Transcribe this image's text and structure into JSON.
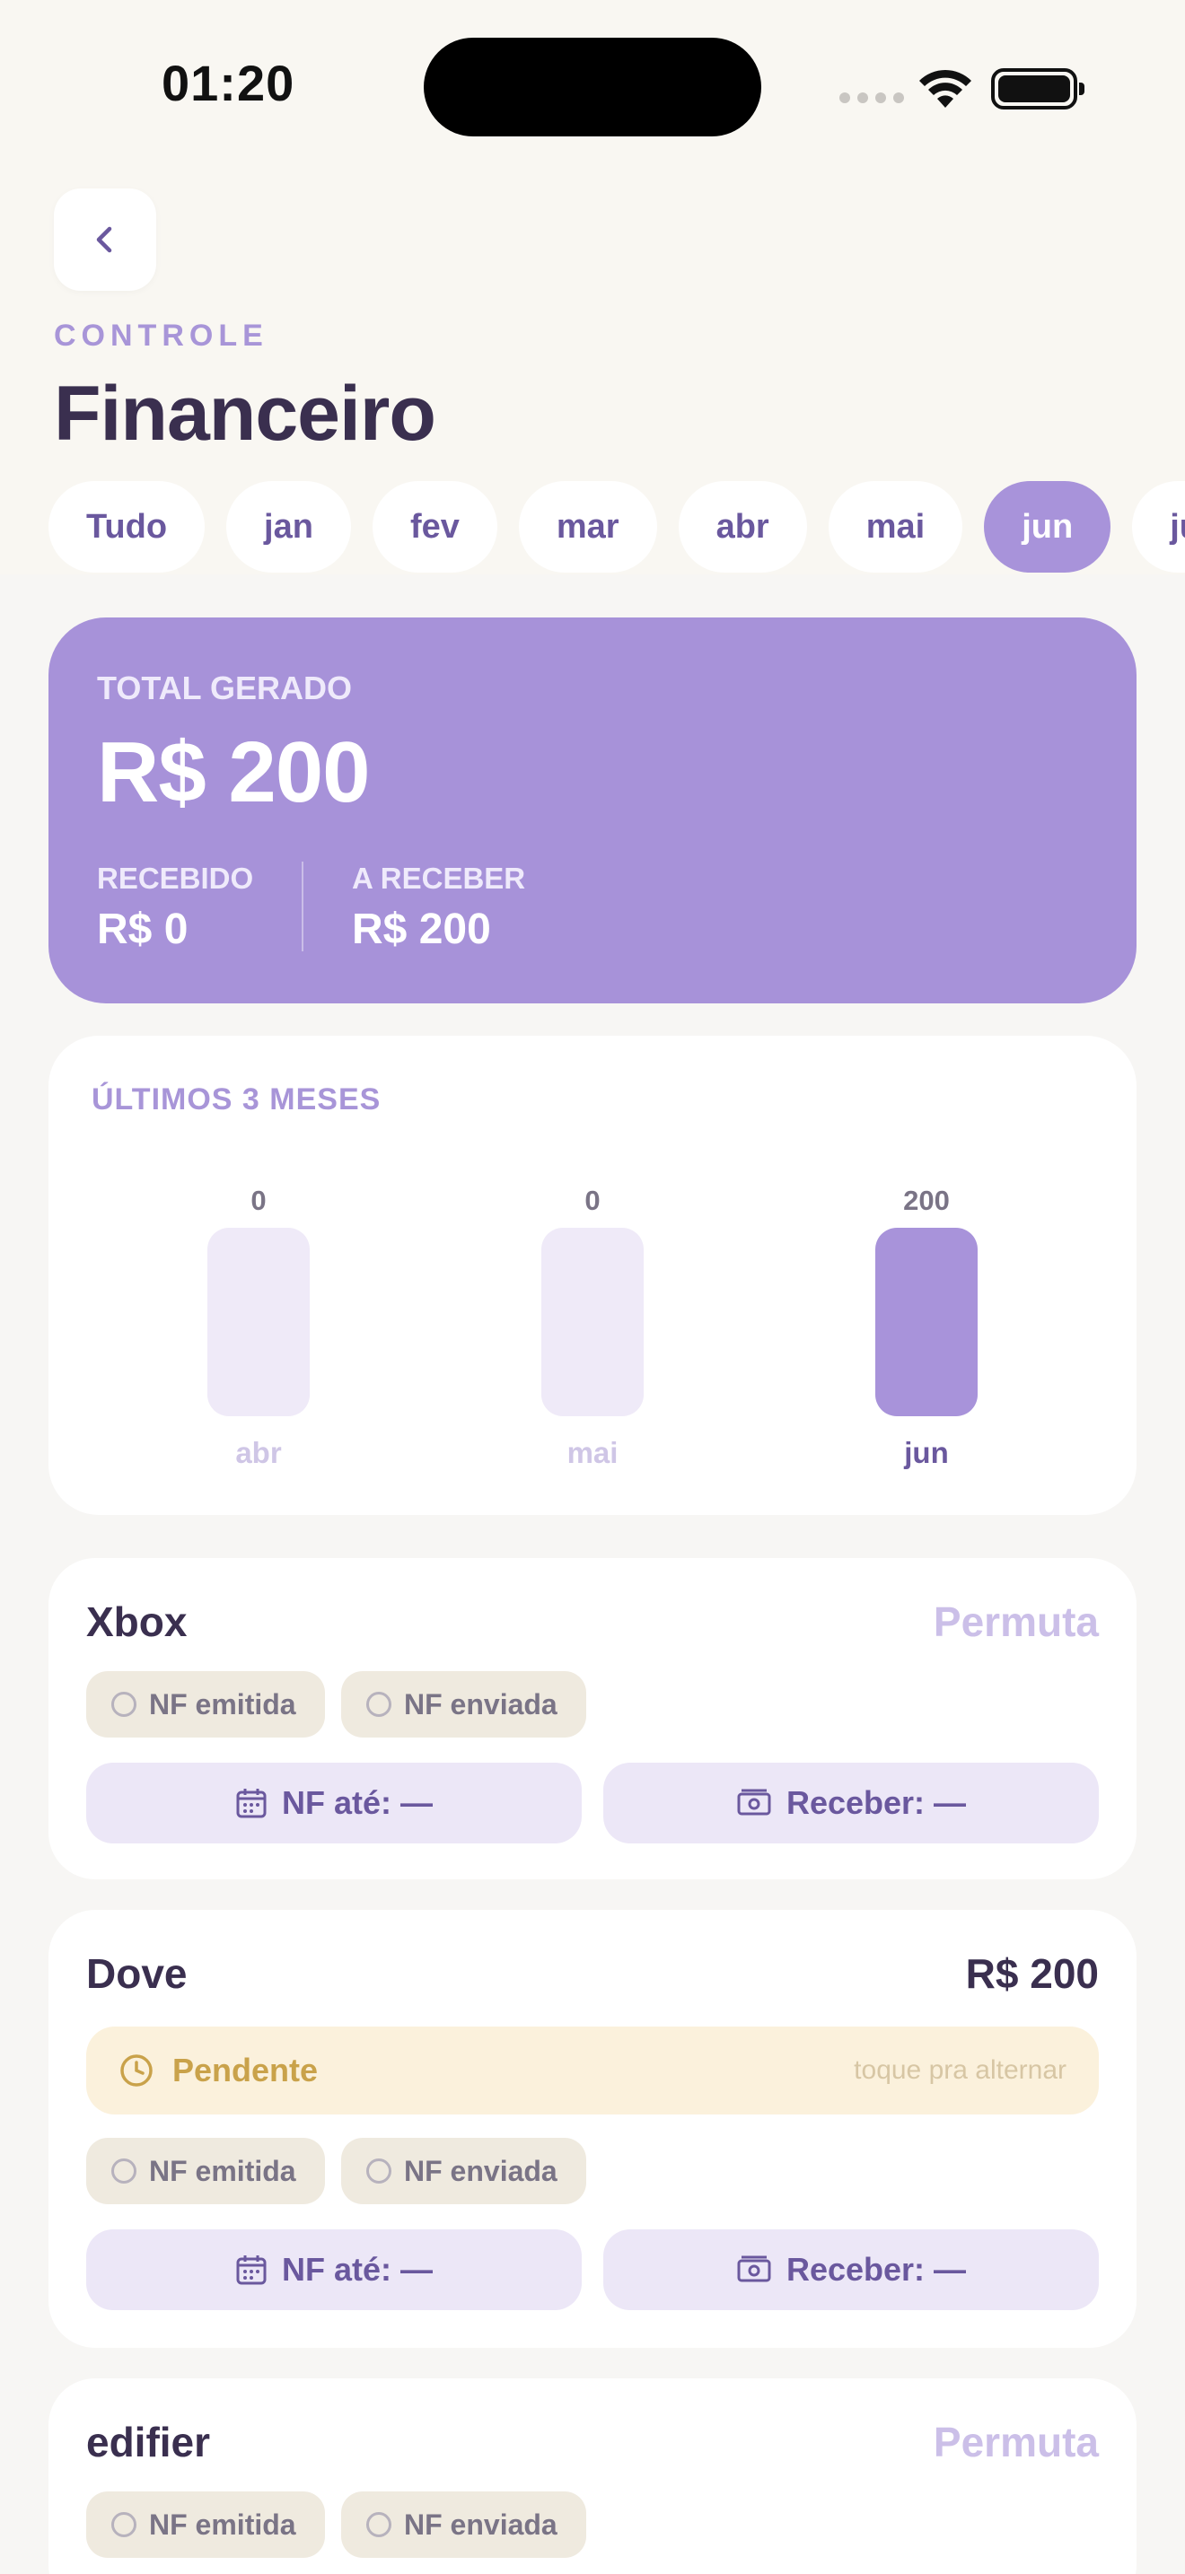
{
  "status_bar": {
    "time": "01:20"
  },
  "header": {
    "eyebrow": "CONTROLE",
    "title": "Financeiro"
  },
  "months": [
    "Tudo",
    "jan",
    "fev",
    "mar",
    "abr",
    "mai",
    "jun",
    "jul"
  ],
  "active_month": "jun",
  "summary": {
    "total_label": "TOTAL GERADO",
    "total_value": "R$ 200",
    "received_label": "RECEBIDO",
    "received_value": "R$ 0",
    "receivable_label": "A RECEBER",
    "receivable_value": "R$ 200"
  },
  "chart_data": {
    "type": "bar",
    "title": "ÚLTIMOS 3 MESES",
    "categories": [
      "abr",
      "mai",
      "jun"
    ],
    "values": [
      0,
      0,
      200
    ],
    "highlight": "jun",
    "colors": {
      "active": "#a893da",
      "inactive": "#efeaf8"
    }
  },
  "entries": [
    {
      "name": "Xbox",
      "amount": "Permuta",
      "nf_issued": "NF emitida",
      "nf_sent": "NF enviada",
      "nf_due": "NF até: —",
      "receive": "Receber: —"
    },
    {
      "name": "Dove",
      "amount": "R$ 200",
      "status": "Pendente",
      "status_hint": "toque pra alternar",
      "nf_issued": "NF emitida",
      "nf_sent": "NF enviada",
      "nf_due": "NF até: —",
      "receive": "Receber: —"
    },
    {
      "name": "edifier",
      "amount": "Permuta",
      "nf_issued": "NF emitida",
      "nf_sent": "NF enviada"
    }
  ],
  "icons": {
    "back": "chevron-left-icon",
    "calendar": "calendar-icon",
    "money": "banknote-icon",
    "clock": "clock-icon"
  }
}
